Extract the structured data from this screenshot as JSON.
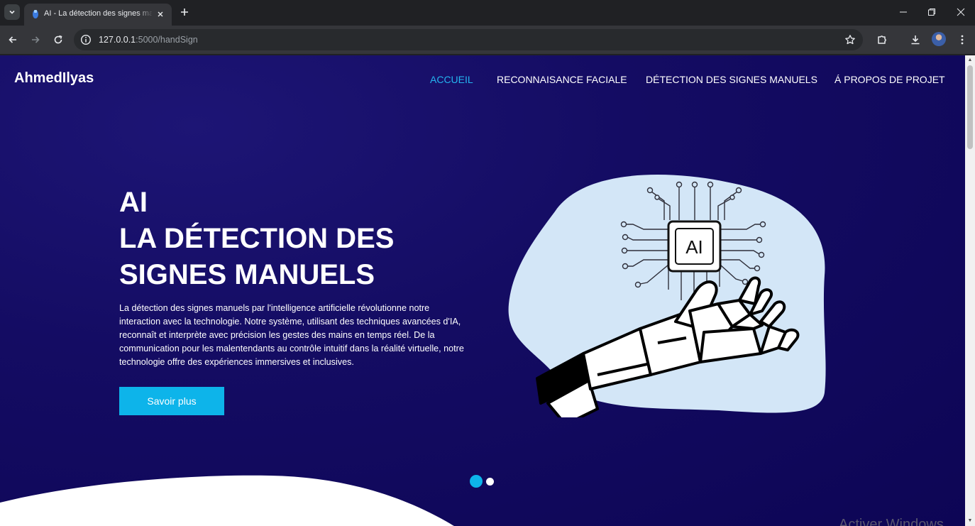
{
  "browser": {
    "tab_title": "AI - La détection des signes manuels",
    "url_host": "127.0.0.1",
    "url_rest": ":5000/handSign",
    "icons": [
      "tab-list-icon",
      "favicon-icon",
      "close-icon",
      "plus-icon",
      "minimize-icon",
      "restore-icon",
      "window-close-icon",
      "back-icon",
      "forward-icon",
      "reload-icon",
      "info-icon",
      "star-icon",
      "extensions-icon",
      "download-icon",
      "menu-icon"
    ]
  },
  "site": {
    "brand": "AhmedIlyas",
    "nav": [
      {
        "label": "Accueil",
        "active": true
      },
      {
        "label": "Reconnaisance faciale",
        "active": false
      },
      {
        "label": "Détection des signes manuels",
        "active": false
      },
      {
        "label": "Á propos de projet",
        "active": false
      }
    ],
    "hero": {
      "title_line1": "AI",
      "title_line2": "LA DÉTECTION DES",
      "title_line3": "SIGNES MANUELS",
      "description": "La détection des signes manuels par l'intelligence artificielle révolutionne notre interaction avec la technologie. Notre système, utilisant des techniques avancées d'IA, reconnaît et interprète avec précision les gestes des mains en temps réel. De la communication pour les malentendants au contrôle intuitif dans la réalité virtuelle, notre technologie offre des expériences immersives et inclusives.",
      "cta_label": "Savoir plus",
      "chip_label": "AI"
    },
    "carousel": {
      "slides": 2,
      "active_index": 0
    }
  },
  "os_watermark": "Activer Windows",
  "colors": {
    "accent": "#24b5f0",
    "button": "#0db4ea",
    "hero_bg": "#140c63",
    "blob": "#d3e6f7"
  }
}
